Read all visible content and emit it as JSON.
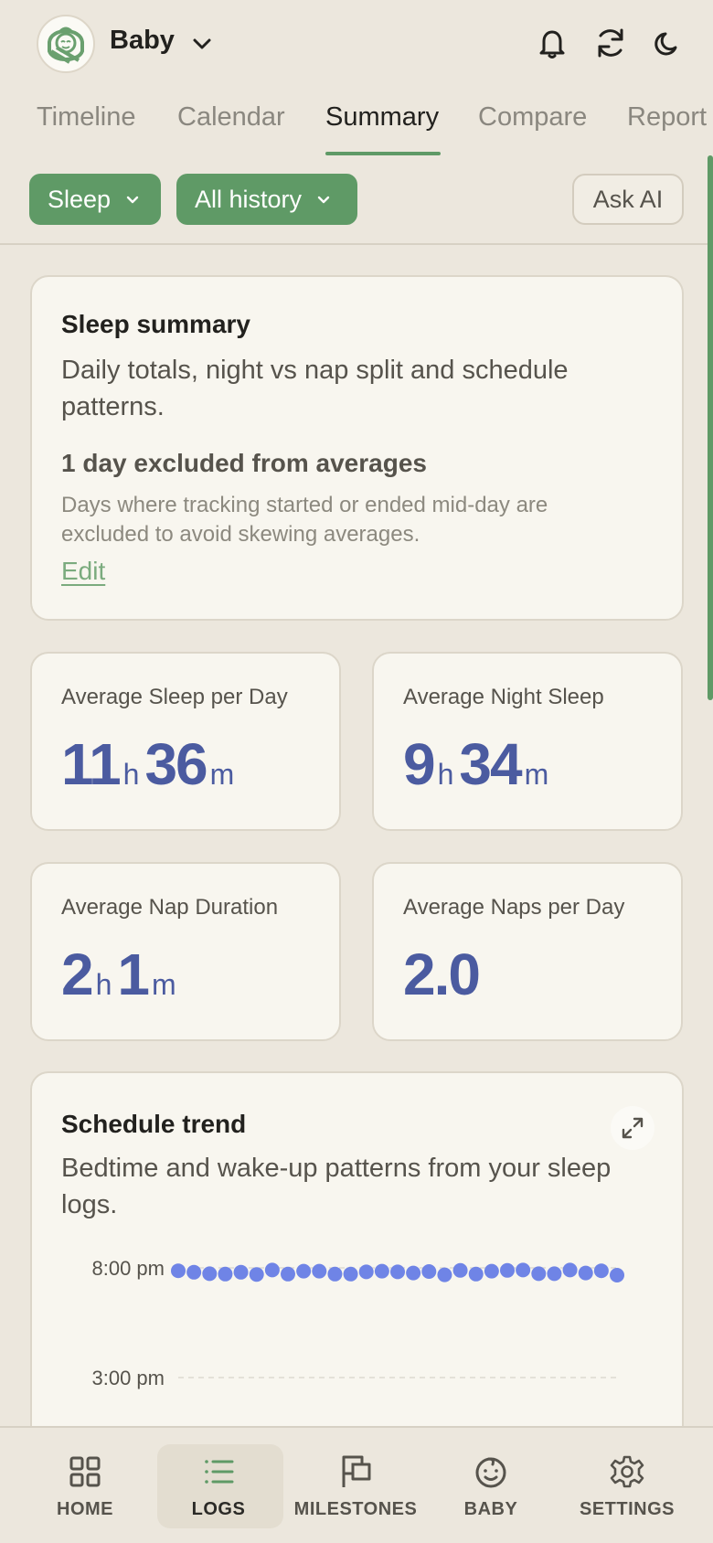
{
  "header": {
    "baby_name": "Baby"
  },
  "tabs": [
    {
      "label": "Timeline"
    },
    {
      "label": "Calendar"
    },
    {
      "label": "Summary",
      "active": true
    },
    {
      "label": "Compare"
    },
    {
      "label": "Report"
    }
  ],
  "filters": {
    "category": "Sleep",
    "range": "All history",
    "ask_ai": "Ask AI"
  },
  "summary": {
    "title": "Sleep summary",
    "description": "Daily totals, night vs nap split and schedule patterns.",
    "excluded_title": "1 day excluded from averages",
    "excluded_description": "Days where tracking started or ended mid-day are excluded to avoid skewing averages.",
    "edit_link": "Edit"
  },
  "stats": {
    "avg_sleep": {
      "label": "Average Sleep per Day",
      "hours": "11",
      "h_unit": "h",
      "minutes": "36",
      "m_unit": "m"
    },
    "avg_night": {
      "label": "Average Night Sleep",
      "hours": "9",
      "h_unit": "h",
      "minutes": "34",
      "m_unit": "m"
    },
    "avg_nap": {
      "label": "Average Nap Duration",
      "hours": "2",
      "h_unit": "h",
      "minutes": "1",
      "m_unit": "m"
    },
    "avg_naps_per_day": {
      "label": "Average Naps per Day",
      "value": "2.0"
    }
  },
  "trend": {
    "title": "Schedule trend",
    "description": "Bedtime and wake-up patterns from your sleep logs."
  },
  "chart_data": {
    "type": "scatter",
    "y_ticks": [
      "8:00 pm",
      "3:00 pm"
    ],
    "y_tick_minutes": [
      1200,
      900
    ],
    "grid": true,
    "series": [
      {
        "color": "#6f84e6",
        "y_minutes": [
          1192,
          1188,
          1184,
          1183,
          1188,
          1182,
          1194,
          1183,
          1191,
          1191,
          1183,
          1183,
          1189,
          1191,
          1189,
          1186,
          1190,
          1181,
          1193,
          1183,
          1191,
          1193,
          1194,
          1184,
          1184,
          1194,
          1186,
          1192,
          1180
        ]
      }
    ]
  },
  "bottom_nav": [
    {
      "label": "HOME",
      "icon": "grid-icon"
    },
    {
      "label": "LOGS",
      "icon": "list-icon",
      "active": true
    },
    {
      "label": "MILESTONES",
      "icon": "flag-icon"
    },
    {
      "label": "BABY",
      "icon": "baby-face-icon"
    },
    {
      "label": "SETTINGS",
      "icon": "gear-icon"
    }
  ],
  "colors": {
    "accent": "#5f9a66",
    "stat_value": "#4b5ba0",
    "background": "#ece7dd",
    "card": "#f8f6ef"
  }
}
